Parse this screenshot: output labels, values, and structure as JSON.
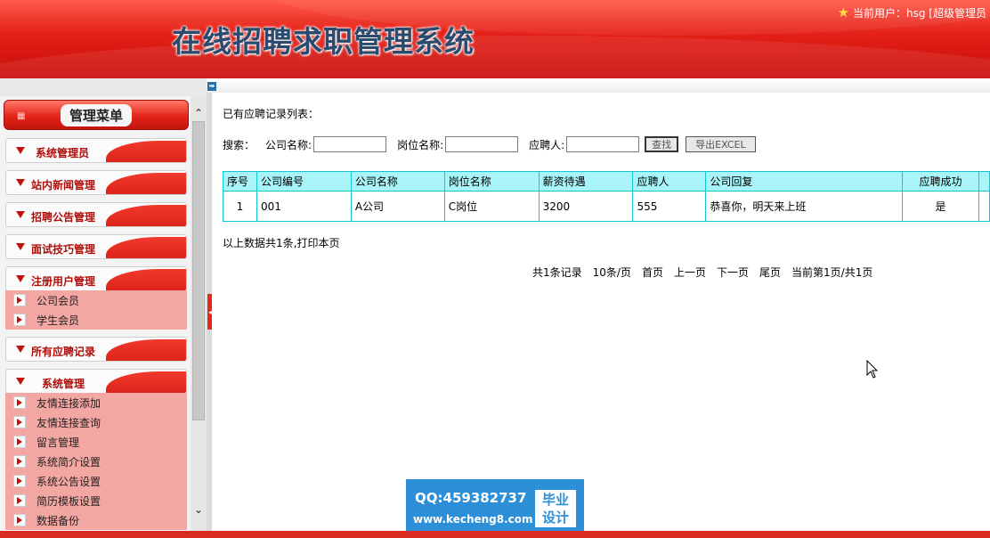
{
  "header": {
    "title": "在线招聘求职管理系统",
    "user_label": "当前用户：hsg [超级管理员"
  },
  "menu": {
    "title": "管理菜单",
    "sections": [
      {
        "label": "系统管理员"
      },
      {
        "label": "站内新闻管理"
      },
      {
        "label": "招聘公告管理"
      },
      {
        "label": "面试技巧管理"
      },
      {
        "label": "注册用户管理",
        "items": [
          "公司会员",
          "学生会员"
        ]
      },
      {
        "label": "所有应聘记录"
      },
      {
        "label": "系统管理",
        "items": [
          "友情连接添加",
          "友情连接查询",
          "留言管理",
          "系统简介设置",
          "系统公告设置",
          "简历模板设置",
          "数据备份"
        ]
      }
    ]
  },
  "main": {
    "caption": "已有应聘记录列表：",
    "search": {
      "label": "搜索：",
      "company_label": "公司名称:",
      "company_value": "",
      "position_label": "岗位名称:",
      "position_value": "",
      "applicant_label": "应聘人:",
      "applicant_value": "",
      "find_button": "查找",
      "export_button": "导出EXCEL"
    },
    "table": {
      "headers": [
        "序号",
        "公司编号",
        "公司名称",
        "岗位名称",
        "薪资待遇",
        "应聘人",
        "公司回复",
        "应聘成功"
      ],
      "rows": [
        [
          "1",
          "001",
          "A公司",
          "C岗位",
          "3200",
          "555",
          "恭喜你，明天来上班",
          "是"
        ]
      ]
    },
    "summary": "以上数据共1条,打印本页",
    "pager": {
      "total": "共1条记录",
      "per_page": "10条/页",
      "first": "首页",
      "prev": "上一页",
      "next": "下一页",
      "last": "尾页",
      "current": "当前第1页/共1页"
    }
  },
  "watermark": {
    "qq": "QQ:459382737",
    "site": "www.kecheng8.com",
    "tag_line1": "毕业",
    "tag_line2": "设计"
  },
  "colors": {
    "header_red": "#e31f17",
    "submenu_bg": "#f3a7a2",
    "table_header": "#a8f4f8",
    "table_border": "#0fc8d4",
    "watermark_blue": "#2d8fd8"
  }
}
